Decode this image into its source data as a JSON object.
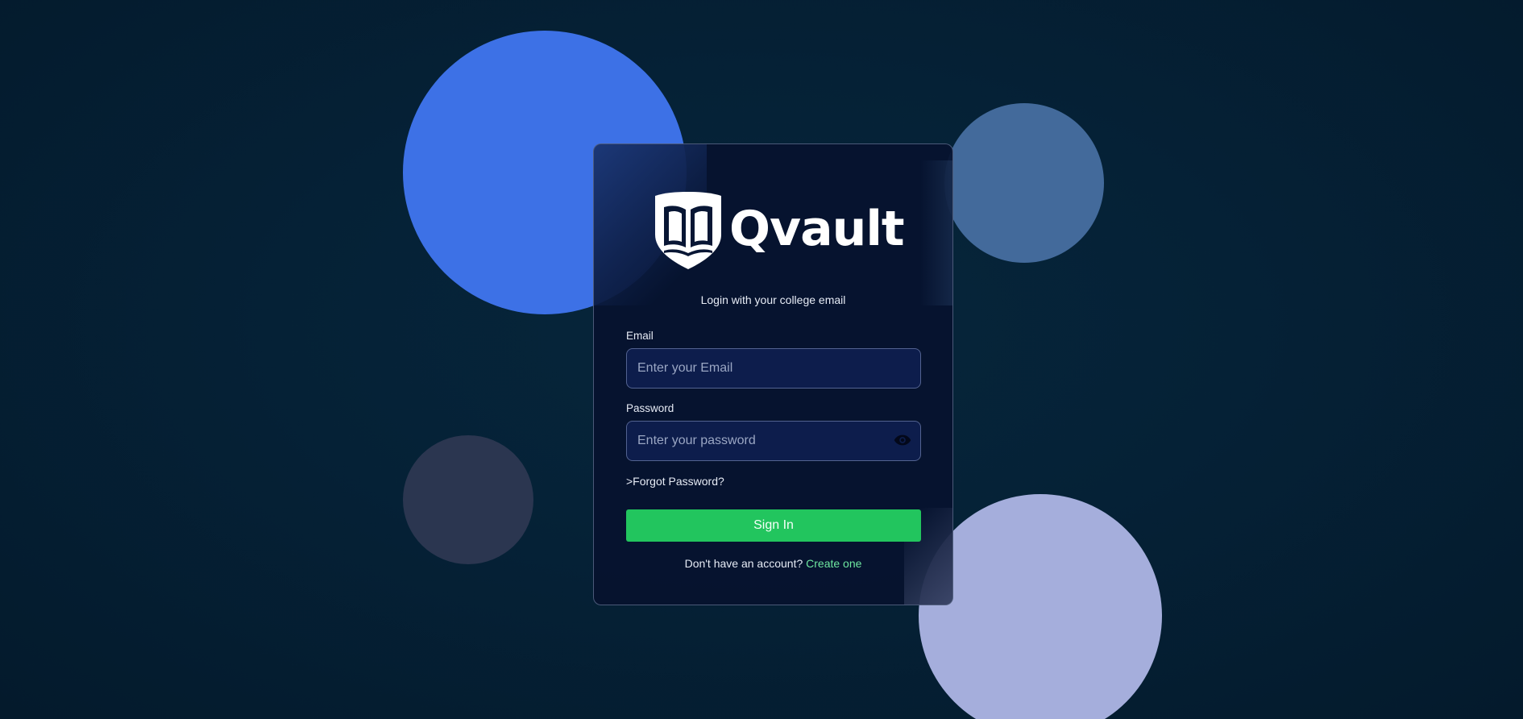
{
  "brand": {
    "name": "Qvault",
    "logo_icon": "shield-book-icon"
  },
  "login": {
    "subtitle": "Login with your college email",
    "email_label": "Email",
    "email_placeholder": "Enter your Email",
    "password_label": "Password",
    "password_placeholder": "Enter your password",
    "password_toggle_icon": "eye-icon",
    "forgot_password": ">Forgot Password?",
    "sign_in_label": "Sign In",
    "no_account_text": "Don't have an account?",
    "create_link": "Create one"
  },
  "theme": {
    "background": "#052136",
    "accent_green": "#22c55e",
    "link_green": "#6ee7a0",
    "circle_colors": [
      "#3d71e6",
      "#436a9b",
      "#2b3650",
      "#a5aedc"
    ]
  }
}
